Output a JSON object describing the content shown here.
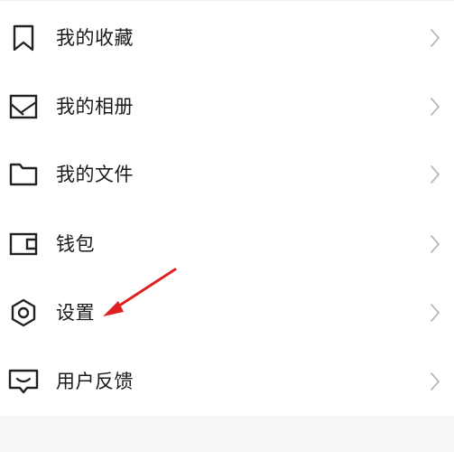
{
  "menu": {
    "items": [
      {
        "label": "我的收藏",
        "icon": "bookmark-icon"
      },
      {
        "label": "我的相册",
        "icon": "image-icon"
      },
      {
        "label": "我的文件",
        "icon": "folder-icon"
      },
      {
        "label": "钱包",
        "icon": "wallet-icon"
      },
      {
        "label": "设置",
        "icon": "settings-icon"
      },
      {
        "label": "用户反馈",
        "icon": "feedback-icon"
      }
    ]
  },
  "colors": {
    "text": "#1a1a1a",
    "icon": "#222222",
    "chevron": "#b8b8b8",
    "annotation_arrow": "#e02020",
    "bottom_band": "#f5f6f7"
  }
}
